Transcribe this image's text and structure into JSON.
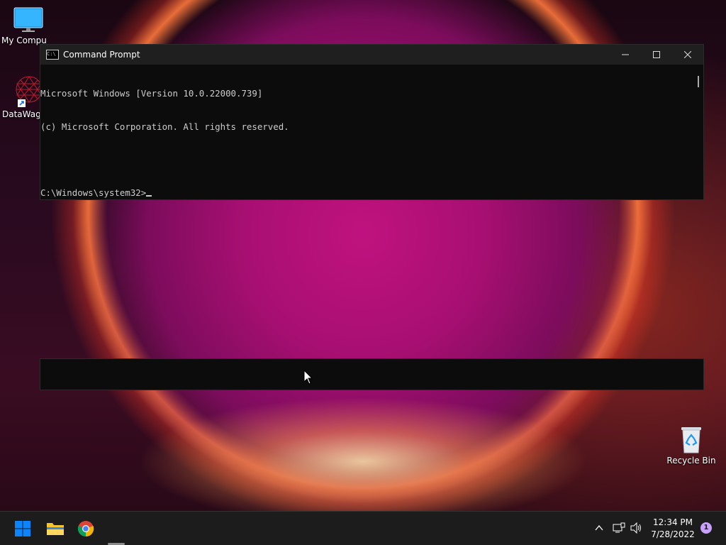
{
  "desktop": {
    "icons": [
      {
        "label": "My Compu"
      },
      {
        "label": "DataWago"
      },
      {
        "label": "Recycle Bin"
      }
    ]
  },
  "cmd": {
    "title": "Command Prompt",
    "lines": [
      "Microsoft Windows [Version 10.0.22000.739]",
      "(c) Microsoft Corporation. All rights reserved.",
      "",
      "C:\\Windows\\system32>"
    ],
    "icon_text": "C:\\"
  },
  "taskbar": {
    "time": "12:34 PM",
    "date": "7/28/2022",
    "notification_count": "1"
  },
  "colors": {
    "console_bg": "#0c0c0c",
    "console_text": "#cccccc",
    "taskbar_bg": "#1c1c1c",
    "win_accent": "#0a84ff"
  }
}
